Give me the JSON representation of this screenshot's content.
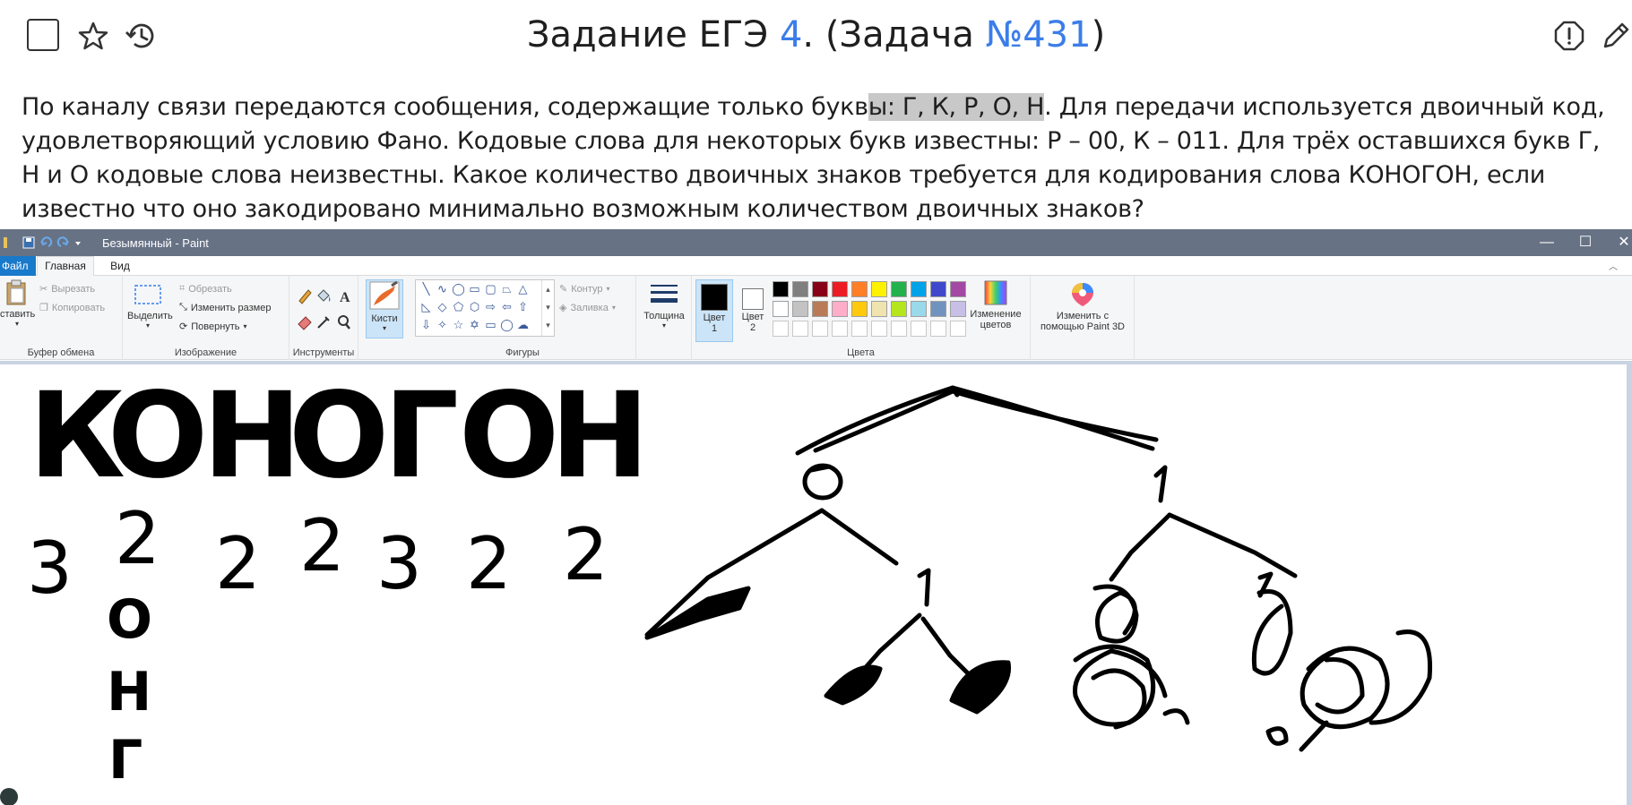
{
  "header": {
    "title_prefix": "Задание ЕГЭ ",
    "task_number": "4",
    "title_middle": ". (Задача ",
    "problem_id": "№431",
    "title_suffix": ")"
  },
  "task": {
    "part1": "По каналу связи передаются сообщения, содержащие только букв",
    "highlight": "ы: Г, К, Р, О, Н",
    "part2": ". Для передачи используется двоичный код, удовлетворяющий условию Фано. Кодовые слова для некоторых букв известны: Р – 00, К – 011. Для трёх оставшихся букв Г, Н и О кодовые слова неизвестны. Какое количество двоичных знаков требуется для кодирования слова КОНОГОН, если известно что оно закодировано минимально возможным количеством двоичных знаков?"
  },
  "paint": {
    "window_title": "Безымянный - Paint",
    "menu": {
      "file": "Файл",
      "home": "Главная",
      "view": "Вид"
    },
    "clipboard": {
      "paste": "ставить",
      "cut": "Вырезать",
      "copy": "Копировать",
      "group": "Буфер обмена"
    },
    "image": {
      "select": "Выделить",
      "crop": "Обрезать",
      "resize": "Изменить размер",
      "rotate": "Повернуть",
      "group": "Изображение"
    },
    "tools": {
      "group": "Инструменты"
    },
    "brushes": {
      "label": "Кисти"
    },
    "shapes": {
      "outline": "Контур",
      "fill": "Заливка",
      "group": "Фигуры"
    },
    "size": {
      "label": "Толщина"
    },
    "colors": {
      "color1_label": "Цвет",
      "color1_num": "1",
      "color2_label": "Цвет",
      "color2_num": "2",
      "edit_label_1": "Изменение",
      "edit_label_2": "цветов",
      "group": "Цвета",
      "color1_value": "#000000",
      "color2_value": "#ffffff",
      "palette_row1": [
        "#000000",
        "#7f7f7f",
        "#880015",
        "#ed1c24",
        "#ff7f27",
        "#fff200",
        "#22b14c",
        "#00a2e8",
        "#3f48cc",
        "#a349a4"
      ],
      "palette_row2": [
        "#ffffff",
        "#c3c3c3",
        "#b97a57",
        "#ffaec9",
        "#ffc90e",
        "#efe4b0",
        "#b5e61d",
        "#99d9ea",
        "#7092be",
        "#c8bfe7"
      ]
    },
    "paint3d": {
      "line1": "Изменить с",
      "line2": "помощью Paint 3D"
    }
  },
  "canvas": {
    "word_letters": [
      "К",
      "О",
      "Н",
      "О",
      "Г",
      "О",
      "Н"
    ],
    "digit_labels": [
      "3",
      "2",
      "2",
      "2",
      "3",
      "2",
      "2"
    ],
    "remaining_letters": [
      "О",
      "Н",
      "Г"
    ],
    "tree_labels": {
      "left": "0",
      "right": "1",
      "lower": "1"
    }
  }
}
